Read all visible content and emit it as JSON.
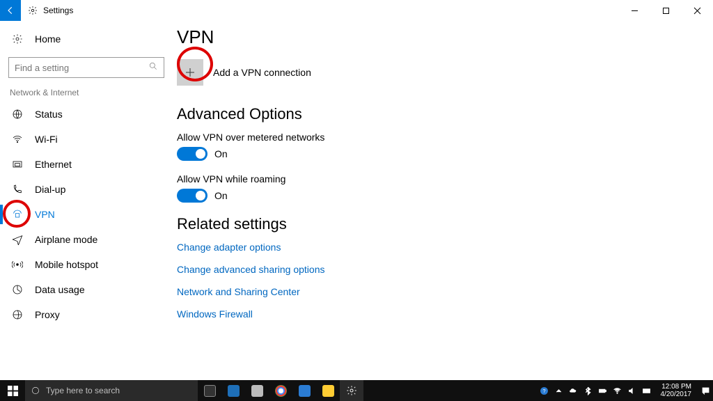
{
  "titlebar": {
    "title": "Settings"
  },
  "sidebar": {
    "home": "Home",
    "search_placeholder": "Find a setting",
    "group": "Network & Internet",
    "items": [
      {
        "label": "Status"
      },
      {
        "label": "Wi-Fi"
      },
      {
        "label": "Ethernet"
      },
      {
        "label": "Dial-up"
      },
      {
        "label": "VPN",
        "selected": true
      },
      {
        "label": "Airplane mode"
      },
      {
        "label": "Mobile hotspot"
      },
      {
        "label": "Data usage"
      },
      {
        "label": "Proxy"
      }
    ]
  },
  "content": {
    "title": "VPN",
    "add_label": "Add a VPN connection",
    "advanced_heading": "Advanced Options",
    "toggle_metered_label": "Allow VPN over metered networks",
    "toggle_metered_state": "On",
    "toggle_roaming_label": "Allow VPN while roaming",
    "toggle_roaming_state": "On",
    "related_heading": "Related settings",
    "links": [
      "Change adapter options",
      "Change advanced sharing options",
      "Network and Sharing Center",
      "Windows Firewall"
    ]
  },
  "taskbar": {
    "search_placeholder": "Type here to search",
    "time": "12:08 PM",
    "date": "4/20/2017",
    "apps": [
      {
        "name": "task-view",
        "color": "#333"
      },
      {
        "name": "edge",
        "color": "#1e6fb8"
      },
      {
        "name": "app-s",
        "color": "#222"
      },
      {
        "name": "chrome",
        "color": "#ffffff"
      },
      {
        "name": "word",
        "color": "#2b7cd3"
      },
      {
        "name": "file-explorer",
        "color": "#ffcc33"
      },
      {
        "name": "settings",
        "color": "#333",
        "active": true
      }
    ]
  }
}
